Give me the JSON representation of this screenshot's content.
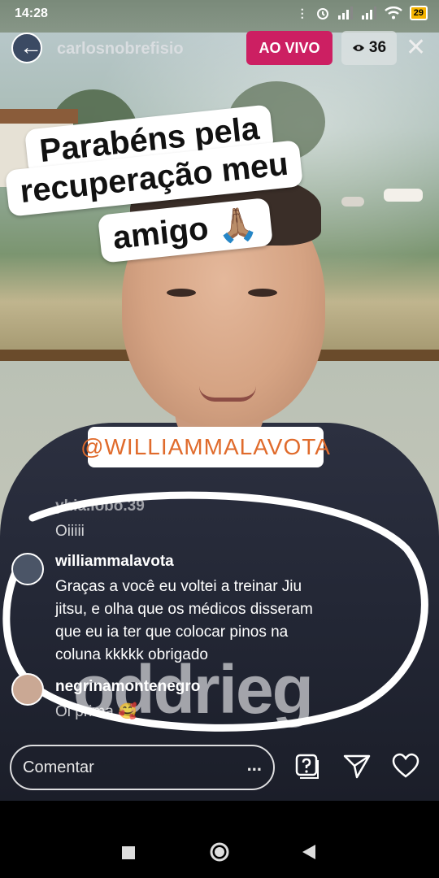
{
  "status_bar": {
    "time": "14:28",
    "battery": "29"
  },
  "live_header": {
    "username": "carlosnobrefisio",
    "live_label": "AO VIVO",
    "viewer_count": "36"
  },
  "sticker": {
    "line1": "Parabéns pela",
    "line2": "recuperação meu",
    "line3": "amigo 🙏🏽"
  },
  "mention": "@WILLIAMMALAVOTA",
  "shirt_text": "oddrieg",
  "comments": [
    {
      "username": "yhia.lobo.39",
      "text": "Oiiiii"
    },
    {
      "username": "williammalavota",
      "text_lines": [
        "Graças a você eu voltei a treinar Jiu",
        "jitsu, e olha que os médicos disseram",
        "que eu ia ter que colocar pinos na",
        "coluna kkkkk obrigado"
      ]
    },
    {
      "username": "negrinamontenegro",
      "text": "Oi prima 🥰"
    }
  ],
  "comment_bar": {
    "placeholder": "Comentar",
    "more": "..."
  },
  "icons": [
    "back-arrow-icon",
    "eye-icon",
    "close-icon",
    "question-icon",
    "send-icon",
    "heart-icon",
    "square-icon",
    "circle-icon",
    "triangle-icon"
  ],
  "colors": {
    "live": "#cc1f62",
    "mention": "#e06b2c"
  }
}
